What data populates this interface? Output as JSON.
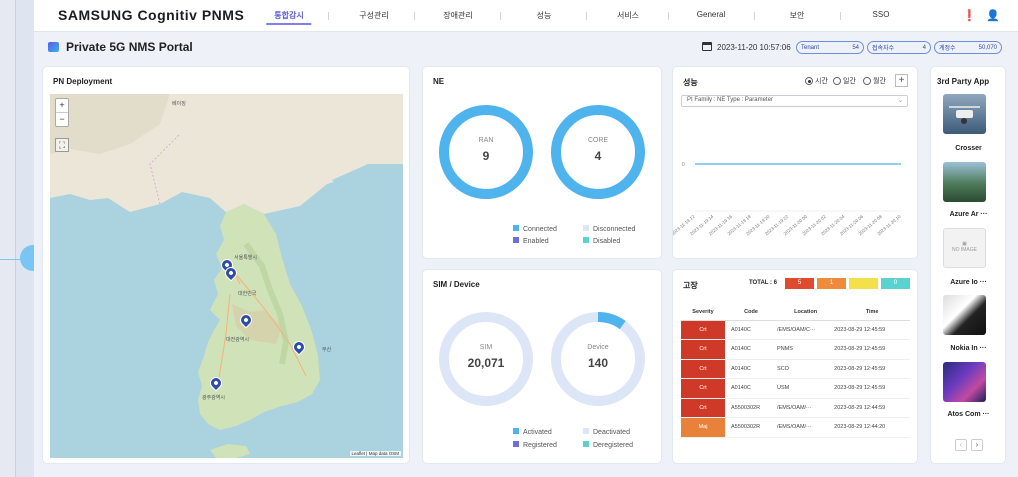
{
  "brand": {
    "name": "SAMSUNG Cognitiv PNMS"
  },
  "nav": {
    "items": [
      {
        "label": "통합감시",
        "active": true
      },
      {
        "label": "구성관리",
        "active": false
      },
      {
        "label": "장애관리",
        "active": false
      },
      {
        "label": "성능",
        "active": false
      },
      {
        "label": "서비스",
        "active": false
      },
      {
        "label": "General",
        "active": false
      },
      {
        "label": "보안",
        "active": false
      },
      {
        "label": "SSO",
        "active": false
      }
    ],
    "icons": [
      "alert-icon",
      "user-icon"
    ]
  },
  "header": {
    "title": "Private 5G NMS Portal",
    "datetime": "2023-11-20 10:57:06",
    "pills": [
      {
        "label": "Tenant",
        "value": "54"
      },
      {
        "label": "접속자수",
        "value": "4"
      },
      {
        "label": "계정수",
        "value": "50,070"
      }
    ]
  },
  "map": {
    "title": "PN Deployment",
    "zoom_in": "+",
    "zoom_out": "−",
    "attribution": "Leaflet | Map data OSM",
    "labels": [
      "베이징",
      "대한민국",
      "대전광역시",
      "광주광역시",
      "부산",
      "서울특별시"
    ]
  },
  "ne": {
    "title": "NE",
    "ran": {
      "label": "RAN",
      "value": "9",
      "fraction": 1.0
    },
    "core": {
      "label": "CORE",
      "value": "4",
      "fraction": 1.0
    },
    "legend": [
      "Connected",
      "Disconnected",
      "Enabled",
      "Disabled"
    ]
  },
  "sim": {
    "title": "SIM / Device",
    "sim": {
      "label": "SIM",
      "value": "20,071",
      "fraction": 0.0
    },
    "device": {
      "label": "Device",
      "value": "140",
      "fraction": 0.1
    },
    "legend": [
      "Activated",
      "Deactivated",
      "Registered",
      "Deregistered"
    ]
  },
  "perf": {
    "title": "성능",
    "radio": [
      {
        "label": "시간",
        "checked": true
      },
      {
        "label": "일간",
        "checked": false
      },
      {
        "label": "월간",
        "checked": false
      }
    ],
    "add_label": "+",
    "select_value": "PI Family : NE Type : Parameter",
    "y_tick": "0",
    "x_ticks": [
      "2023-11-19 12",
      "2023-11-19 14",
      "2023-11-19 16",
      "2023-11-19 18",
      "2023-11-19 20",
      "2023-11-19 22",
      "2023-11-20 00",
      "2023-11-20 02",
      "2023-11-20 04",
      "2023-11-20 06",
      "2023-11-20 08",
      "2023-11-20 10"
    ]
  },
  "fault": {
    "title": "고장",
    "total_label": "TOTAL : 6",
    "counts": [
      {
        "value": "5",
        "color": "#e04a2f"
      },
      {
        "value": "1",
        "color": "#ef8c3c"
      },
      {
        "value": "",
        "color": "#f4e04b"
      },
      {
        "value": "0",
        "color": "#59d3cf"
      }
    ],
    "columns": [
      "Severity",
      "Code",
      "Location",
      "Time"
    ],
    "rows": [
      {
        "severity": "Crt",
        "code": "A0140C",
        "location": "/EMS/OAM/C···",
        "time": "2023-08-29 12:45:59",
        "color": "#cf3a28"
      },
      {
        "severity": "Crt",
        "code": "A0140C",
        "location": "PNMS",
        "time": "2023-08-29 12:45:59",
        "color": "#cf3a28"
      },
      {
        "severity": "Crt",
        "code": "A0140C",
        "location": "SCO",
        "time": "2023-08-29 12:45:59",
        "color": "#cf3a28"
      },
      {
        "severity": "Crt",
        "code": "A0140C",
        "location": "USM",
        "time": "2023-08-29 12:45:59",
        "color": "#cf3a28"
      },
      {
        "severity": "Crt",
        "code": "A5500302R",
        "location": "/EMS/OAM/···",
        "time": "2023-08-29 12:44:59",
        "color": "#cf3a28"
      },
      {
        "severity": "Maj",
        "code": "A5500302R",
        "location": "/EMS/OAM/···",
        "time": "2023-08-29 12:44:20",
        "color": "#e8813a"
      }
    ]
  },
  "third_party": {
    "title": "3rd Party App",
    "apps": [
      {
        "name": "Crosser"
      },
      {
        "name": "Azure Ar ···"
      },
      {
        "name": "Azure Io ···"
      },
      {
        "name": "Nokia In ···"
      },
      {
        "name": "Atos Com ···"
      }
    ],
    "no_image": "NO IMAGE",
    "prev": "‹",
    "next": "›"
  }
}
